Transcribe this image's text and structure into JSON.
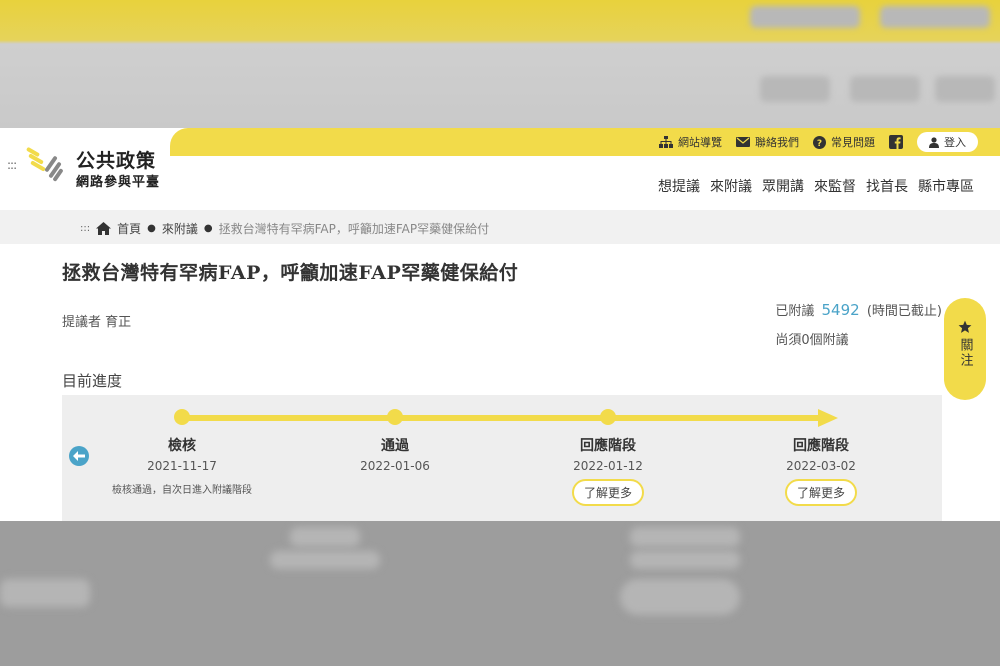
{
  "brand": {
    "line1": "公共政策",
    "line2": "網路參與平臺"
  },
  "utility_nav": {
    "sitemap": "網站導覽",
    "contact": "聯絡我們",
    "faq": "常見問題",
    "login": "登入"
  },
  "main_nav": [
    "想提議",
    "來附議",
    "眾開講",
    "來監督",
    "找首長",
    "縣市專區"
  ],
  "breadcrumb": {
    "home": "首頁",
    "section": "來附議",
    "current": "拯救台灣特有罕病FAP，呼籲加速FAP罕藥健保給付"
  },
  "proposal": {
    "title": "拯救台灣特有罕病FAP，呼籲加速FAP罕藥健保給付",
    "proposer_label": "提議者",
    "proposer_name": "育正"
  },
  "stats": {
    "signed_label": "已附議",
    "signed_count": "5492",
    "deadline_note": "(時間已截止)",
    "remaining": "尚須0個附議"
  },
  "follow_label": "關注",
  "progress": {
    "label": "目前進度",
    "stages": [
      {
        "name": "檢核",
        "date": "2021-11-17",
        "note": "檢核通過，自次日進入附議階段"
      },
      {
        "name": "通過",
        "date": "2022-01-06"
      },
      {
        "name": "回應階段",
        "date": "2022-01-12",
        "more": "了解更多"
      },
      {
        "name": "回應階段",
        "date": "2022-03-02",
        "more": "了解更多"
      }
    ]
  },
  "colors": {
    "brand_yellow": "#f2db4a",
    "accent_blue": "#4aa3c8"
  }
}
